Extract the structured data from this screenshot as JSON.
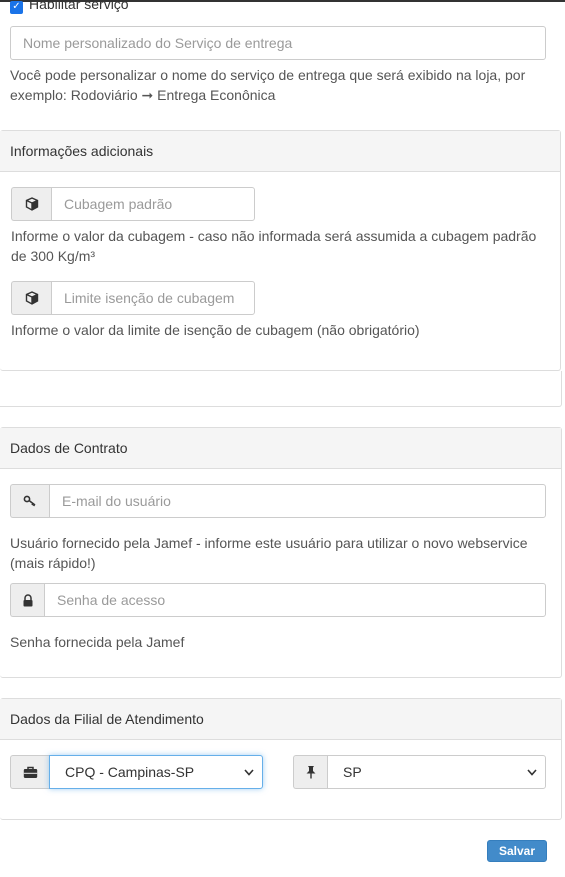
{
  "service": {
    "enable_label": "Habilitar serviço",
    "enabled": true,
    "name_placeholder": "Nome personalizado do Serviço de entrega",
    "name_help": "Você pode personalizar o nome do serviço de entrega que será exibido na loja, por exemplo: Rodoviário ➞ Entrega Econônica"
  },
  "additional": {
    "title": "Informações adicionais",
    "cubage_placeholder": "Cubagem padrão",
    "cubage_help": "Informe o valor da cubagem - caso não informada será assumida a cubagem padrão de 300 Kg/m³",
    "exemption_placeholder": "Limite isenção de cubagem",
    "exemption_help": "Informe o valor da limite de isenção de cubagem (não obrigatório)"
  },
  "contract": {
    "title": "Dados de Contrato",
    "email_placeholder": "E-mail do usuário",
    "email_help": "Usuário fornecido pela Jamef - informe este usuário para utilizar o novo webservice (mais rápido!)",
    "password_placeholder": "Senha de acesso",
    "password_help": "Senha fornecida pela Jamef"
  },
  "branch": {
    "title": "Dados da Filial de Atendimento",
    "branch_selected": "CPQ - Campinas-SP",
    "state_selected": "SP"
  },
  "actions": {
    "save_label": "Salvar"
  },
  "icons": [
    "check-icon",
    "cube-icon",
    "key-icon",
    "lock-icon",
    "briefcase-icon",
    "pin-icon",
    "chevron-down-icon"
  ],
  "colors": {
    "accent": "#428bca",
    "checkbox": "#1a73e8",
    "panel_heading": "#f5f5f5",
    "border": "#dddddd",
    "focus": "#66afe9"
  }
}
